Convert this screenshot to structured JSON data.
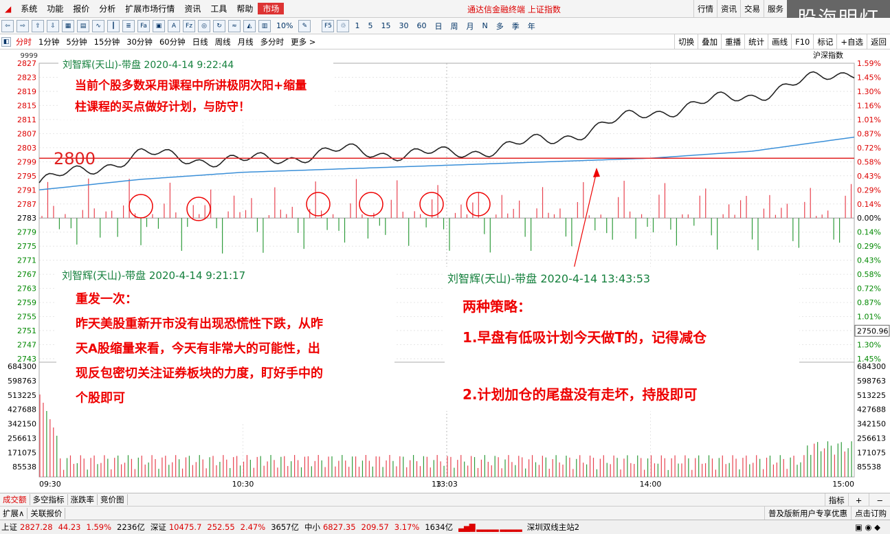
{
  "menu": {
    "items": [
      "系统",
      "功能",
      "报价",
      "分析",
      "扩展市场行情",
      "资讯",
      "工具",
      "帮助"
    ],
    "active": "市场",
    "title": "通达信金融终端 上证指数",
    "right": [
      "行情",
      "资讯",
      "交易",
      "服务"
    ]
  },
  "toolbar": {
    "percent": "10%",
    "periods": [
      "1",
      "5",
      "15",
      "30",
      "60",
      "日",
      "周",
      "月",
      "N",
      "多",
      "季",
      "年"
    ]
  },
  "logo": "股海明灯",
  "periodbar": {
    "items": [
      "分时",
      "1分钟",
      "5分钟",
      "15分钟",
      "30分钟",
      "60分钟",
      "日线",
      "周线",
      "月线",
      "多分时",
      "更多 >"
    ],
    "active": "分时",
    "right": [
      "切换",
      "叠加",
      "重播",
      "统计",
      "画线",
      "F10",
      "标记",
      "+自选",
      "返回"
    ],
    "index_label": "沪深指数"
  },
  "chart": {
    "top_left": "9999",
    "price_axis": [
      "2827",
      "2823",
      "2819",
      "2815",
      "2811",
      "2807",
      "2803",
      "2799",
      "2795",
      "2791",
      "2787",
      "2783",
      "2779",
      "2775",
      "2771",
      "2767",
      "2763",
      "2759",
      "2755",
      "2751",
      "2747",
      "2743"
    ],
    "pct_axis": [
      "1.59%",
      "1.45%",
      "1.30%",
      "1.16%",
      "1.01%",
      "0.87%",
      "0.72%",
      "0.58%",
      "0.43%",
      "0.29%",
      "0.14%",
      "0.00%",
      "0.14%",
      "0.29%",
      "0.43%",
      "0.58%",
      "0.72%",
      "0.87%",
      "1.01%",
      "1.16%",
      "1.30%",
      "1.45%"
    ],
    "vol_axis": [
      "684300",
      "598763",
      "513225",
      "427688",
      "342150",
      "256613",
      "171075",
      "85538"
    ],
    "time_axis": [
      "09:30",
      "10:30",
      "13:03",
      "14:00",
      "15:00"
    ],
    "time_marker_left": "13",
    "current_price_tag": "2750.96",
    "level_label": "2800",
    "colors": {
      "price_line": "#222222",
      "avg_line": "#3a8fd8",
      "up": "#e8414e",
      "down": "#2e9b3a",
      "level": "#e02020"
    }
  },
  "chart_data": {
    "type": "line",
    "title": "",
    "xlabel": "",
    "ylabel": "",
    "ylim": [
      2743,
      2827
    ],
    "x": [
      "09:30",
      "10:00",
      "10:30",
      "11:00",
      "11:30/13:00",
      "13:30",
      "14:00",
      "14:30",
      "15:00"
    ],
    "series": [
      {
        "values": [
          2793,
          2801,
          2799,
          2802,
          2801,
          2805,
          2813,
          2818,
          2825
        ]
      },
      {
        "values": [
          2791,
          2794,
          2796,
          2797,
          2798,
          2799,
          2800,
          2802,
          2806
        ]
      }
    ]
  },
  "notes": {
    "note1": {
      "head": "刘智辉(天山)-带盘 2020-4-14 9:22:44",
      "lines": [
        "当前个股多数采用课程中所讲极阴次阳+缩量",
        "柱课程的买点做好计划，与防守！"
      ]
    },
    "note2": {
      "head": "刘智辉(天山)-带盘 2020-4-14 9:21:17",
      "lines": [
        "重发一次：",
        "昨天美股重新开市没有出现恐慌性下跌，从昨",
        "天A股缩量来看，今天有非常大的可能性，出",
        "现反包密切关注证券板块的力度，盯好手中的",
        "个股即可"
      ]
    },
    "note3": {
      "head": "刘智辉(天山)-带盘 2020-4-14 13:43:53",
      "lines": [
        "两种策略：",
        "1.早盘有低吸计划今天做T的，记得减仓",
        "",
        "2.计划加仓的尾盘没有走坏，持股即可"
      ]
    }
  },
  "tabs": [
    "成交额",
    "多空指标",
    "涨跌率",
    "竞价图"
  ],
  "tabs_right": [
    "指标",
    "+",
    "−"
  ],
  "tabs2": [
    "扩展∧",
    "关联报价"
  ],
  "tabs2_right": "普及版新用户专享优惠",
  "tabs2_right2": "点击订购",
  "status": {
    "sh_label": "上证",
    "sh_val": "2827.28",
    "sh_chg": "44.23",
    "sh_pct": "1.59%",
    "sh_amt": "2236亿",
    "sz_label": "深证",
    "sz_val": "10475.7",
    "sz_chg": "252.55",
    "sz_pct": "2.47%",
    "sz_amt": "3657亿",
    "zx_label": "中小",
    "zx_val": "6827.35",
    "zx_chg": "209.57",
    "zx_pct": "3.17%",
    "zx_amt": "1634亿",
    "server": "深圳双线主站2"
  }
}
